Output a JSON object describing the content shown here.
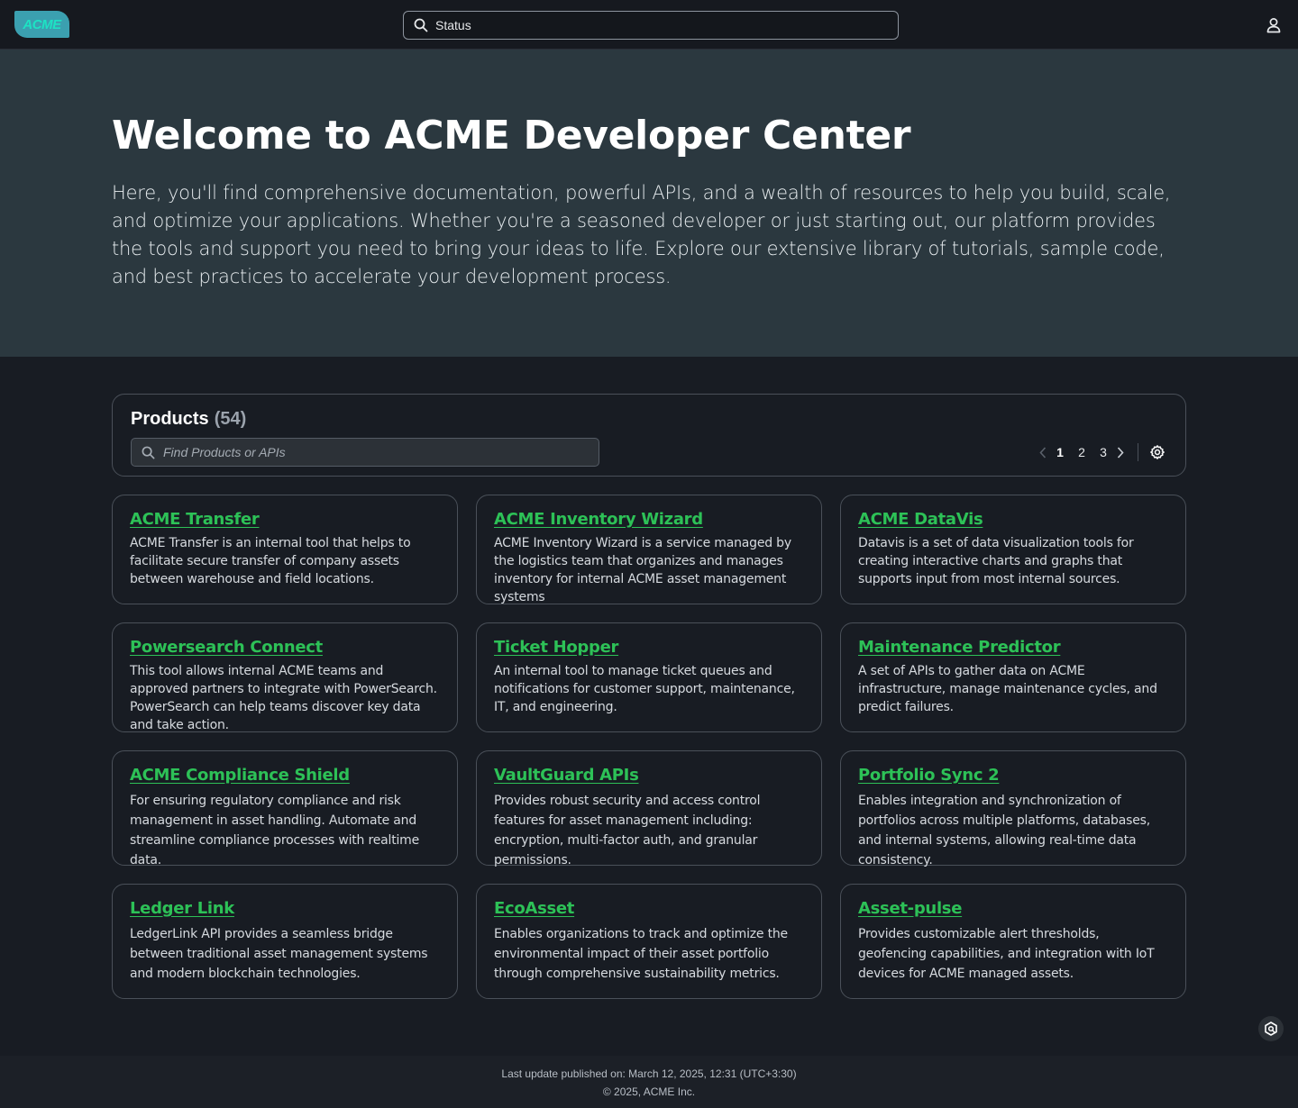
{
  "header": {
    "logo_text": "ACME",
    "search_value": "Status"
  },
  "hero": {
    "title": "Welcome to ACME Developer Center",
    "description": "Here, you'll find comprehensive documentation, powerful  APIs, and a wealth of resources to help you build, scale, and optimize your applications. Whether you're a seasoned developer or just starting out, our platform provides the tools and support you need to bring your ideas to life. Explore our extensive library of tutorials, sample code, and best practices to accelerate your development process."
  },
  "products": {
    "title": "Products",
    "count": "(54)",
    "search_placeholder": "Find Products or APIs",
    "pagination": {
      "pages": [
        "1",
        "2",
        "3"
      ],
      "current": "1"
    },
    "cards": [
      {
        "title": "ACME Transfer",
        "description": "ACME Transfer is an internal tool that helps to facilitate secure transfer of company assets between warehouse and field locations."
      },
      {
        "title": "ACME Inventory Wizard",
        "description": "ACME Inventory Wizard is a service managed by the logistics team that organizes and manages inventory for internal ACME asset management systems"
      },
      {
        "title": "ACME DataVis",
        "description": "Datavis is a set of data visualization tools for creating interactive charts and graphs that supports input from most internal sources."
      },
      {
        "title": "Powersearch Connect",
        "description": "This tool allows internal ACME teams and approved partners to integrate with PowerSearch. PowerSearch can help teams discover key data and take action."
      },
      {
        "title": "Ticket Hopper",
        "description": "An internal tool to manage ticket queues and notifications for customer support, maintenance, IT, and engineering."
      },
      {
        "title": "Maintenance Predictor",
        "description": "A set of APIs to gather data on ACME infrastructure, manage maintenance cycles, and predict failures."
      },
      {
        "title": "ACME Compliance Shield",
        "description": "For ensuring regulatory compliance and risk management in asset handling. Automate and streamline compliance processes with realtime data."
      },
      {
        "title": "VaultGuard APIs",
        "description": "Provides robust security and access control features for asset management including: encryption, multi-factor auth, and granular permissions."
      },
      {
        "title": "Portfolio Sync 2",
        "description": "Enables integration and synchronization of portfolios across multiple platforms, databases, and internal systems, allowing real-time data consistency."
      },
      {
        "title": "Ledger Link",
        "description": "LedgerLink API provides a seamless bridge between traditional asset management systems and modern blockchain technologies."
      },
      {
        "title": "EcoAsset",
        "description": "Enables organizations to track and optimize the environmental impact of their asset portfolio through comprehensive sustainability metrics."
      },
      {
        "title": "Asset-pulse",
        "description": "Provides customizable alert thresholds, geofencing capabilities, and integration with IoT devices for ACME managed assets."
      }
    ]
  },
  "footer": {
    "last_update": "Last update published on: March 12, 2025, 12:31 (UTC+3:30)",
    "copyright": "© 2025, ACME Inc."
  },
  "colors": {
    "accent_link": "#2dc157",
    "hero_bg": "#2b383f",
    "page_bg": "#181c23",
    "logo_bg": "#3ba0b0"
  },
  "icons": [
    "search-icon",
    "user-icon",
    "chevron-left-icon",
    "chevron-right-icon",
    "gear-icon",
    "help-widget-icon"
  ]
}
